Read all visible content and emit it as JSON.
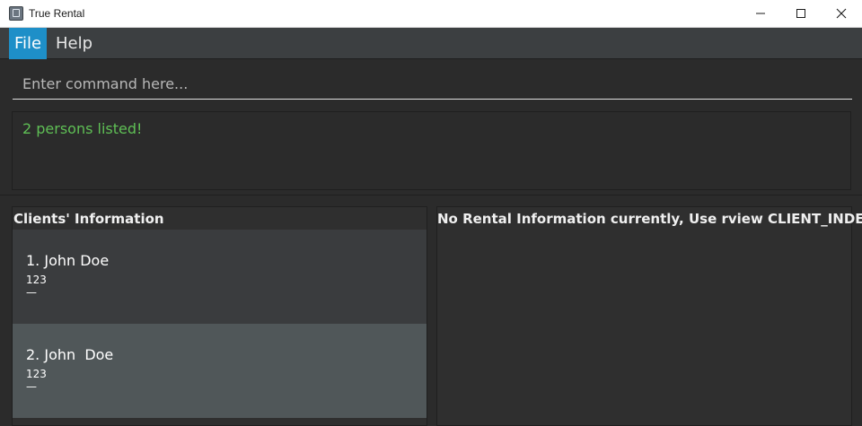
{
  "window": {
    "title": "True Rental",
    "icon": "app-icon",
    "controls": [
      "minimize-icon",
      "maximize-icon",
      "close-icon"
    ]
  },
  "menu": {
    "items": [
      {
        "label": "File",
        "active": true
      },
      {
        "label": "Help",
        "active": false
      }
    ]
  },
  "command": {
    "placeholder": "Enter command here...",
    "value": ""
  },
  "result": {
    "text": "2 persons listed!",
    "color": "#5fbf55"
  },
  "clients": {
    "header": "Clients' Information",
    "list": [
      {
        "name": "1. John Doe",
        "phone": "123",
        "extra": "—"
      },
      {
        "name": "2. John  Doe",
        "phone": "123",
        "extra": "—"
      }
    ]
  },
  "rental": {
    "header": "No Rental Information currently, Use rview CLIENT_INDEX"
  },
  "colors": {
    "accent": "#1e8fc8",
    "background": "#2b2b2b",
    "selected_row": "#505759"
  }
}
